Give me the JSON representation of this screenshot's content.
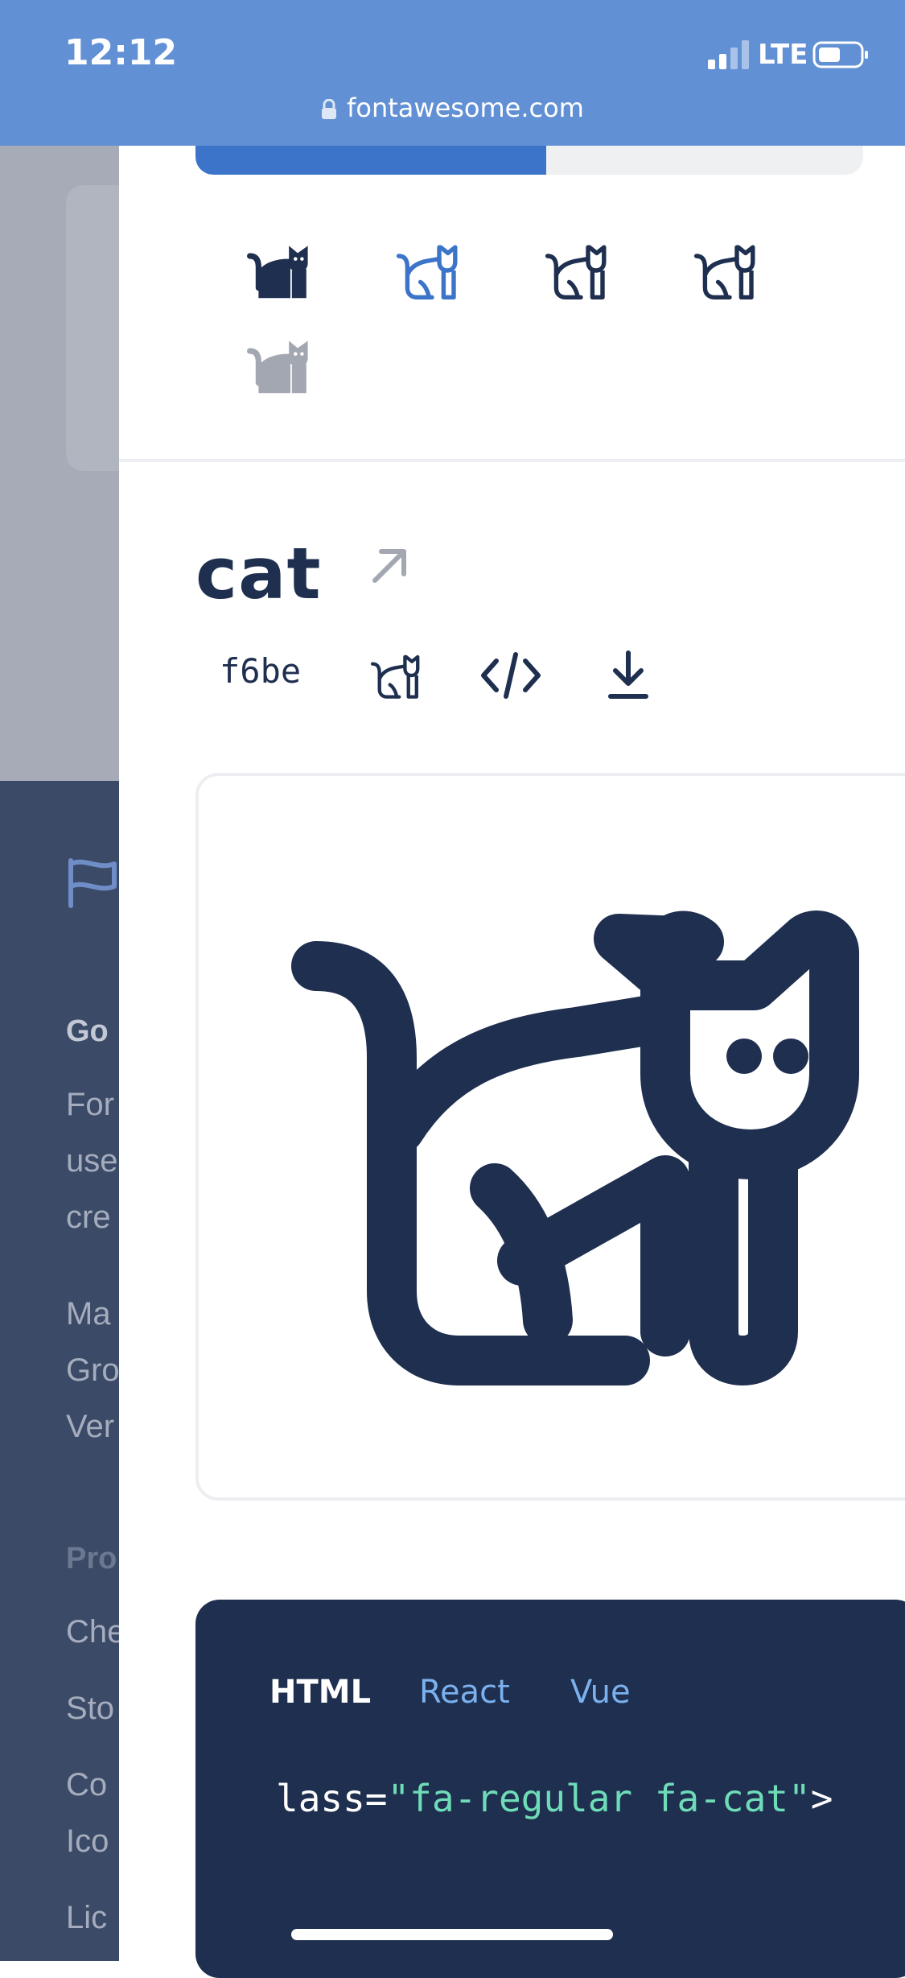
{
  "status_bar": {
    "time": "12:12",
    "network": "LTE",
    "url": "fontawesome.com"
  },
  "background_nav": {
    "heading": "Go",
    "lines": [
      "For",
      "use",
      "cre",
      "Ma",
      "Gro",
      "Ver"
    ],
    "section_heading": "Pro",
    "items": [
      "Che",
      "Sto",
      "Co",
      "Ico",
      "Lic"
    ]
  },
  "icon": {
    "name": "cat",
    "unicode": "f6be",
    "style_variants": [
      "solid",
      "regular",
      "light",
      "thin",
      "duotone"
    ],
    "active_style": "regular",
    "colors": {
      "primary": "#1e2f4f",
      "active": "#3b74c9",
      "muted": "#a3a7b1"
    }
  },
  "code": {
    "tabs": [
      "HTML",
      "React",
      "Vue"
    ],
    "active_tab": "HTML",
    "snippet_prefix": "lass=",
    "snippet_string": "\"fa-regular fa-cat\"",
    "snippet_suffix": ">"
  }
}
